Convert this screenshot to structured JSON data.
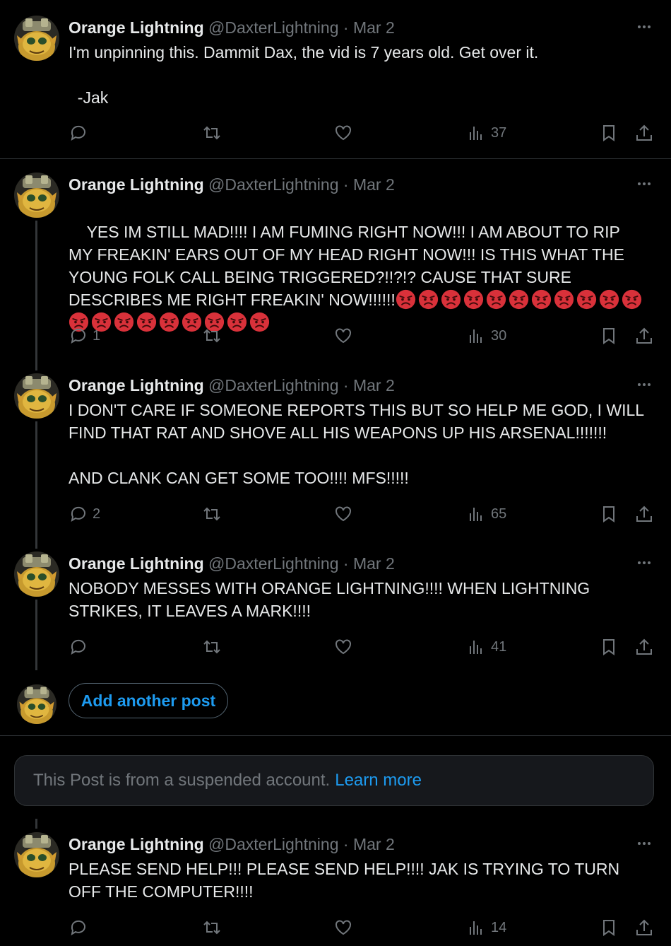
{
  "user": {
    "name": "Orange Lightning",
    "handle": "@DaxterLightning",
    "separator": "·",
    "date": "Mar 2"
  },
  "posts": [
    {
      "text": "I'm unpinning this. Dammit Dax, the vid is 7 years old. Get over it.\n\n  -Jak",
      "replies": "",
      "views": "37",
      "emoji_count": 0
    },
    {
      "text": "YES IM STILL MAD!!!! I AM FUMING RIGHT NOW!!! I AM ABOUT TO RIP MY FREAKIN' EARS OUT OF MY HEAD RIGHT NOW!!! IS THIS WHAT THE YOUNG FOLK CALL BEING TRIGGERED?!!?!? CAUSE THAT SURE DESCRIBES ME RIGHT FREAKIN' NOW!!!!!!",
      "replies": "1",
      "views": "30",
      "emoji_count": 20,
      "emoji_name": "enraged-face"
    },
    {
      "text": "I DON'T CARE IF SOMEONE REPORTS THIS BUT SO HELP ME GOD, I WILL FIND THAT RAT AND SHOVE ALL HIS WEAPONS UP HIS ARSENAL!!!!!!!\n\nAND CLANK CAN GET SOME TOO!!!! MFS!!!!!",
      "replies": "2",
      "views": "65",
      "emoji_count": 0
    },
    {
      "text": "NOBODY MESSES WITH ORANGE LIGHTNING!!!! WHEN LIGHTNING STRIKES, IT LEAVES A MARK!!!!",
      "replies": "",
      "views": "41",
      "emoji_count": 0
    },
    {
      "text": "PLEASE SEND HELP!!! PLEASE SEND HELP!!!! JAK IS TRYING TO TURN OFF THE COMPUTER!!!!",
      "replies": "",
      "views": "14",
      "emoji_count": 0
    }
  ],
  "composer": {
    "add_label": "Add another post"
  },
  "suspended": {
    "text": "This Post is from a suspended account.",
    "link": "Learn more"
  },
  "icons": {
    "reply": "reply-icon",
    "repost": "repost-icon",
    "like": "like-icon",
    "views": "views-icon",
    "bookmark": "bookmark-icon",
    "share": "share-icon",
    "more": "more-icon"
  },
  "colors": {
    "background": "#000000",
    "text": "#e7e9ea",
    "muted": "#71767b",
    "accent": "#1d9bf0",
    "divider": "#2f3336"
  }
}
